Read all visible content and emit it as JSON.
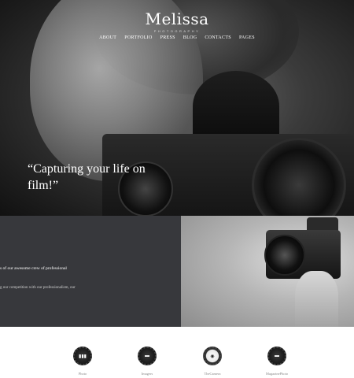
{
  "brand": {
    "name": "Melissa",
    "subtitle": "PHOTOGRAPHY"
  },
  "nav": {
    "items": [
      "ABOUT",
      "PORTFOLIO",
      "PRESS",
      "BLOG",
      "CONTACTS",
      "PAGES"
    ]
  },
  "hero": {
    "tagline": "“Capturing your life on film!”"
  },
  "intro": {
    "line1": "s of our awesome crew of professional",
    "line2": "g our competition with our professionalism, our"
  },
  "press": {
    "badges": [
      {
        "caption": "Photo",
        "icon": "photo-seal-icon"
      },
      {
        "caption": "Imagers",
        "icon": "imagers-seal-icon"
      },
      {
        "caption": "TheCamera",
        "icon": "thecamera-seal-icon"
      },
      {
        "caption": "MagazinePhoto",
        "icon": "magazinephoto-seal-icon"
      }
    ]
  }
}
